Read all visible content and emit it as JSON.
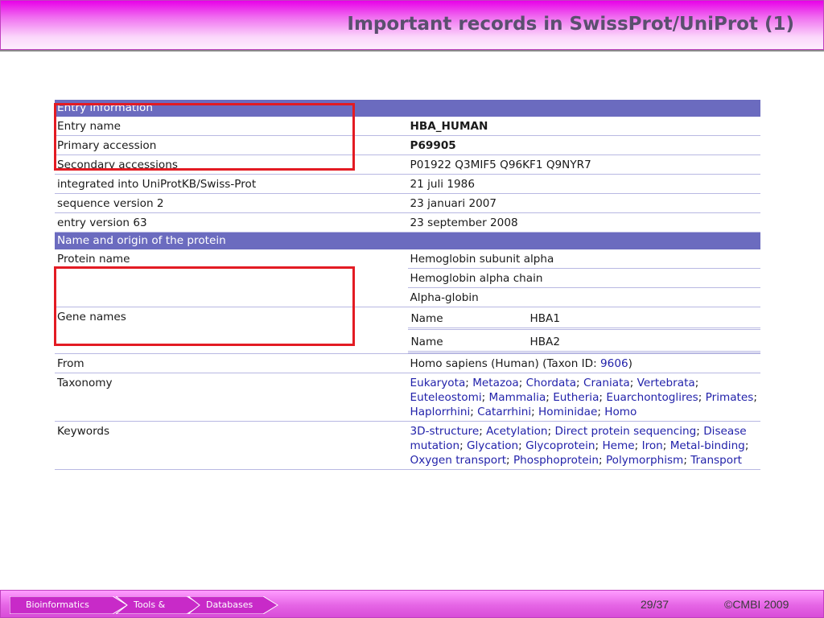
{
  "slide": {
    "title": "Important records in SwissProt/UniProt (1)"
  },
  "entry_info": {
    "header": "Entry information",
    "rows": [
      {
        "label": "Entry name",
        "value": "HBA_HUMAN"
      },
      {
        "label": "Primary accession",
        "value": "P69905"
      },
      {
        "label": "Secondary accessions",
        "value": "P01922 Q3MIF5 Q96KF1 Q9NYR7"
      },
      {
        "label": "integrated into UniProtKB/Swiss-Prot",
        "value": "21 juli 1986"
      },
      {
        "label": "sequence version 2",
        "value": "23 januari 2007"
      },
      {
        "label": "entry version 63",
        "value": "23 september 2008"
      }
    ]
  },
  "name_origin": {
    "header": "Name and origin of the protein",
    "protein_name_label": "Protein name",
    "protein_names": [
      "Hemoglobin subunit alpha",
      "Hemoglobin alpha chain",
      "Alpha-globin"
    ],
    "gene_names_label": "Gene names",
    "genes": [
      {
        "key": "Name",
        "value": "HBA1"
      },
      {
        "key": "Name",
        "value": "HBA2"
      }
    ],
    "from_label": "From",
    "from_prefix": "Homo sapiens (Human) (Taxon ID: ",
    "from_taxon_id": "9606",
    "from_suffix": ")",
    "taxonomy_label": "Taxonomy",
    "taxonomy": [
      "Eukaryota",
      "Metazoa",
      "Chordata",
      "Craniata",
      "Vertebrata",
      "Euteleostomi",
      "Mammalia",
      "Eutheria",
      "Euarchontoglires",
      "Primates",
      "Haplorrhini",
      "Catarrhini",
      "Hominidae",
      "Homo"
    ],
    "keywords_label": "Keywords",
    "keywords": [
      "3D-structure",
      "Acetylation",
      "Direct protein sequencing",
      "Disease mutation",
      "Glycation",
      "Glycoprotein",
      "Heme",
      "Iron",
      "Metal-binding",
      "Oxygen transport",
      "Phosphoprotein",
      "Polymorphism",
      "Transport"
    ]
  },
  "footer": {
    "breadcrumbs": [
      "Bioinformatics",
      "Tools &",
      "Databases"
    ],
    "page": "29/37",
    "copyright": "©CMBI 2009"
  },
  "colors": {
    "header_magenta": "#e800e8",
    "section_header": "#6b6bbf",
    "highlight_box": "#e31b23",
    "link": "#2222aa"
  }
}
